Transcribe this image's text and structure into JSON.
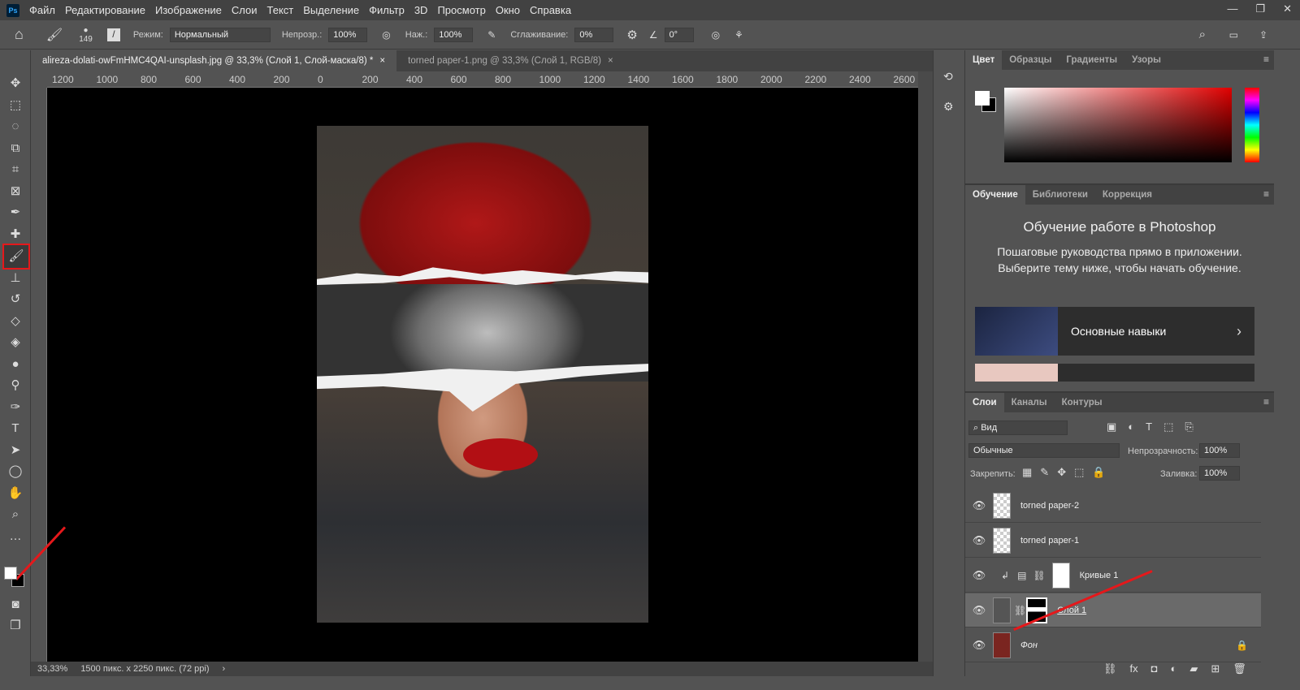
{
  "app": {
    "logo": "Ps",
    "menu": [
      "Файл",
      "Редактирование",
      "Изображение",
      "Слои",
      "Текст",
      "Выделение",
      "Фильтр",
      "3D",
      "Просмотр",
      "Окно",
      "Справка"
    ]
  },
  "options": {
    "brush_size": "149",
    "mode_label": "Режим:",
    "mode_value": "Нормальный",
    "opacity_label": "Непрозр.:",
    "opacity_value": "100%",
    "flow_label": "Наж.:",
    "flow_value": "100%",
    "smoothing_label": "Сглаживание:",
    "smoothing_value": "0%",
    "angle_value": "0°"
  },
  "tabs": [
    {
      "label": "alireza-dolati-owFmHMC4QAI-unsplash.jpg @ 33,3% (Слой 1, Слой-маска/8) *",
      "active": true
    },
    {
      "label": "torned paper-1.png @ 33,3% (Слой 1, RGB/8)",
      "active": false
    }
  ],
  "ruler_h": [
    "1200",
    "1000",
    "800",
    "600",
    "400",
    "200",
    "0",
    "200",
    "400",
    "600",
    "800",
    "1000",
    "1200",
    "1400",
    "1600",
    "1800",
    "2000",
    "2200",
    "2400",
    "2600"
  ],
  "status": {
    "zoom": "33,33%",
    "doc": "1500 пикс. x 2250 пикс. (72 ppi)"
  },
  "color_panel": {
    "tabs": [
      "Цвет",
      "Образцы",
      "Градиенты",
      "Узоры"
    ],
    "hue_color": "#ff0000"
  },
  "learn_panel": {
    "tabs": [
      "Обучение",
      "Библиотеки",
      "Коррекция"
    ],
    "title": "Обучение работе в Photoshop",
    "text": "Пошаговые руководства прямо в приложении. Выберите тему ниже, чтобы начать обучение.",
    "card": "Основные навыки"
  },
  "layers_panel": {
    "tabs": [
      "Слои",
      "Каналы",
      "Контуры"
    ],
    "filter": "Вид",
    "blend": "Обычные",
    "opacity_label": "Непрозрачность:",
    "opacity": "100%",
    "lock_label": "Закрепить:",
    "fill_label": "Заливка:",
    "fill": "100%",
    "layers": [
      {
        "name": "torned paper-2"
      },
      {
        "name": "torned paper-1"
      },
      {
        "name": "Кривые 1"
      },
      {
        "name": "Слой 1",
        "selected": true
      },
      {
        "name": "Фон"
      }
    ]
  },
  "accent": "#e5181b"
}
